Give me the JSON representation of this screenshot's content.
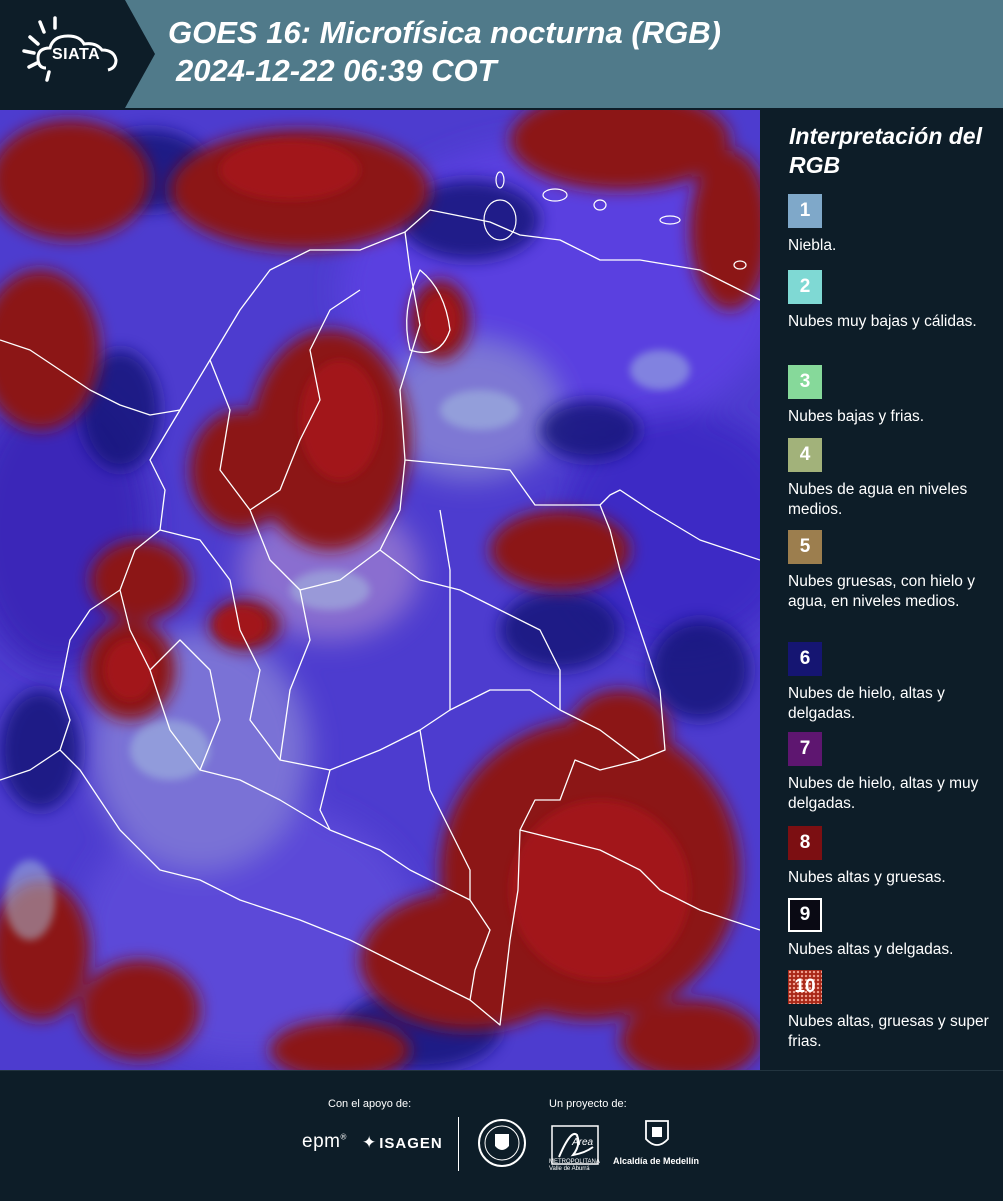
{
  "header": {
    "logo_text": "SIATA",
    "title_line1": "GOES 16: Microfísica nocturna (RGB)",
    "title_line2": "2024-12-22 06:39 COT"
  },
  "legend": {
    "title": "Interpretación del RGB",
    "items": [
      {
        "number": "1",
        "label": "Niebla.",
        "color": "#7fa8c9"
      },
      {
        "number": "2",
        "label": "Nubes muy bajas y cálidas.",
        "color": "#7fd9d4"
      },
      {
        "number": "3",
        "label": "Nubes bajas y frias.",
        "color": "#86d99a"
      },
      {
        "number": "4",
        "label": "Nubes de agua en niveles medios.",
        "color": "#a2b27a"
      },
      {
        "number": "5",
        "label": "Nubes gruesas, con hielo y agua, en niveles medios.",
        "color": "#9c7e4e"
      },
      {
        "number": "6",
        "label": "Nubes de hielo, altas y delgadas.",
        "color": "#151572"
      },
      {
        "number": "7",
        "label": "Nubes de hielo, altas y muy delgadas.",
        "color": "#5e1670"
      },
      {
        "number": "8",
        "label": "Nubes altas y gruesas.",
        "color": "#7c0f12"
      },
      {
        "number": "9",
        "label": "Nubes altas y delgadas.",
        "color": "#0a0a14"
      },
      {
        "number": "10",
        "label": "Nubes altas, gruesas y super frias.",
        "color": "#a82818"
      }
    ]
  },
  "footer": {
    "support_label": "Con el apoyo de:",
    "project_label": "Un proyecto de:",
    "epm": "epm",
    "isagen": "ISAGEN",
    "area_logo_text": "Área",
    "area_subtext": "METROPOLITANA Valle de Aburrá",
    "alcaldia": "Alcaldía de Medellín"
  }
}
